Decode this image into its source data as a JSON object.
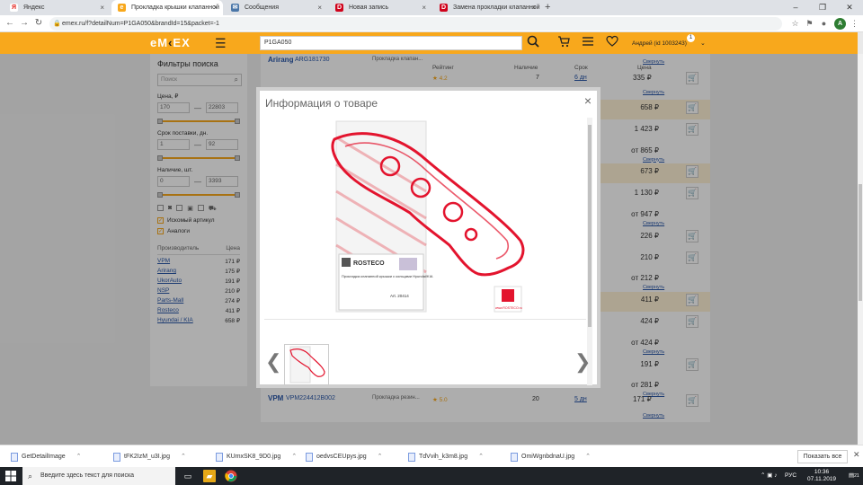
{
  "browser": {
    "tabs": [
      {
        "title": "Яндекс",
        "icon": "yandex-icon",
        "color": "#e52620"
      },
      {
        "title": "Прокладка крышки клапанной",
        "icon": "emex-icon",
        "color": "#f8a81c"
      },
      {
        "title": "Сообщения",
        "icon": "messages-icon",
        "color": "#4a76a8"
      },
      {
        "title": "Новая запись",
        "icon": "drive2-icon",
        "color": "#d0021b"
      },
      {
        "title": "Замена прокладки клапанной",
        "icon": "drive2-icon",
        "color": "#d0021b"
      }
    ],
    "url": "emex.ru/f?detailNum=P1GA050&brandId=15&packet=-1",
    "window_minimize": "–",
    "window_maximize": "❐",
    "window_close": "✕"
  },
  "site": {
    "logo_text_1": "e",
    "logo_text_2": "M",
    "logo_text_3": "EX",
    "search_value": "P1GA050",
    "user_name": "Андрей (id 1003243)",
    "notification_count": "1",
    "accent_color": "#f8a81c"
  },
  "filters": {
    "title": "Фильтры поиска",
    "search_placeholder": "Поиск",
    "price_label": "Цена, ₽",
    "price_min": "170",
    "price_max": "22803",
    "delivery_label": "Срок поставки, дн.",
    "delivery_min": "1",
    "delivery_max": "92",
    "stock_label": "Наличие, шт.",
    "stock_min": "0",
    "stock_max": "3393",
    "exact_article": "Искомый артикул",
    "analogs": "Аналоги",
    "maker_header": "Производитель",
    "price_header": "Цена",
    "makers": [
      {
        "name": "VPM",
        "price": "171 ₽"
      },
      {
        "name": "Arirang",
        "price": "175 ₽"
      },
      {
        "name": "UkorAuto",
        "price": "191 ₽"
      },
      {
        "name": "NSP",
        "price": "210 ₽"
      },
      {
        "name": "Parts-Mall",
        "price": "274 ₽"
      },
      {
        "name": "Rosteco",
        "price": "411 ₽"
      },
      {
        "name": "Hyundai / KIA",
        "price": "658 ₽"
      }
    ]
  },
  "results": {
    "headers": {
      "rating": "Рейтинг",
      "stock": "Наличие",
      "term": "Срок",
      "price": "Цена"
    },
    "top_row": {
      "brand": "Arirang",
      "article": "ARG181730",
      "desc": "Прокладка клапан...",
      "rating": "★ 4.2",
      "stock": "7",
      "term": "6 дн",
      "price": "335 ₽",
      "more": "Свернуть"
    },
    "rows": [
      {
        "price": "658 ₽",
        "more": "",
        "hl": true
      },
      {
        "price": "1 423 ₽",
        "more": "",
        "hl": false
      },
      {
        "price": "от 865 ₽",
        "more": "Свернуть",
        "hl": false
      },
      {
        "price": "673 ₽",
        "more": "",
        "hl": true
      },
      {
        "price": "1 130 ₽",
        "more": "",
        "hl": false
      },
      {
        "price": "от 947 ₽",
        "more": "Свернуть",
        "hl": false
      },
      {
        "price": "226 ₽",
        "more": "",
        "hl": false
      },
      {
        "price": "210 ₽",
        "more": "",
        "hl": false
      },
      {
        "price": "от 212 ₽",
        "more": "Свернуть",
        "hl": false
      },
      {
        "price": "411 ₽",
        "more": "",
        "hl": true
      },
      {
        "price": "424 ₽",
        "more": "",
        "hl": false
      },
      {
        "price": "от 424 ₽",
        "more": "Свернуть",
        "hl": false
      },
      {
        "price": "191 ₽",
        "more": "",
        "hl": false
      },
      {
        "price": "от 281 ₽",
        "more": "Свернуть",
        "hl": false
      }
    ],
    "bottom_row": {
      "brand": "VPM",
      "article": "VPM224412B002",
      "desc": "Прокладка резин...",
      "rating": "★ 5.0",
      "stock": "20",
      "term": "5 дн",
      "price": "171 ₽",
      "more": "Свернуть"
    }
  },
  "modal": {
    "title": "Информация о товаре",
    "close": "×",
    "product": {
      "brand": "ROSTECO",
      "desc": "Прокладка клапанной крышки с кольцами Hyundai/KIA",
      "art": "Art. 20414",
      "site": "www.ROSTECO.ru"
    },
    "prev": "❮",
    "next": "❯"
  },
  "downloads": {
    "items": [
      "GetDetailImage",
      "tFK2IzM_u3I.jpg",
      "KUmxSK8_9D0.jpg",
      "oedvsCEUpys.jpg",
      "TdVvih_k3m8.jpg",
      "OmiWgnbdnaU.jpg"
    ],
    "show_all": "Показать все",
    "close": "✕"
  },
  "taskbar": {
    "search_placeholder": "Введите здесь текст для поиска",
    "lang": "РУС",
    "time": "10:36",
    "date": "07.11.2019",
    "notifications": "21"
  }
}
